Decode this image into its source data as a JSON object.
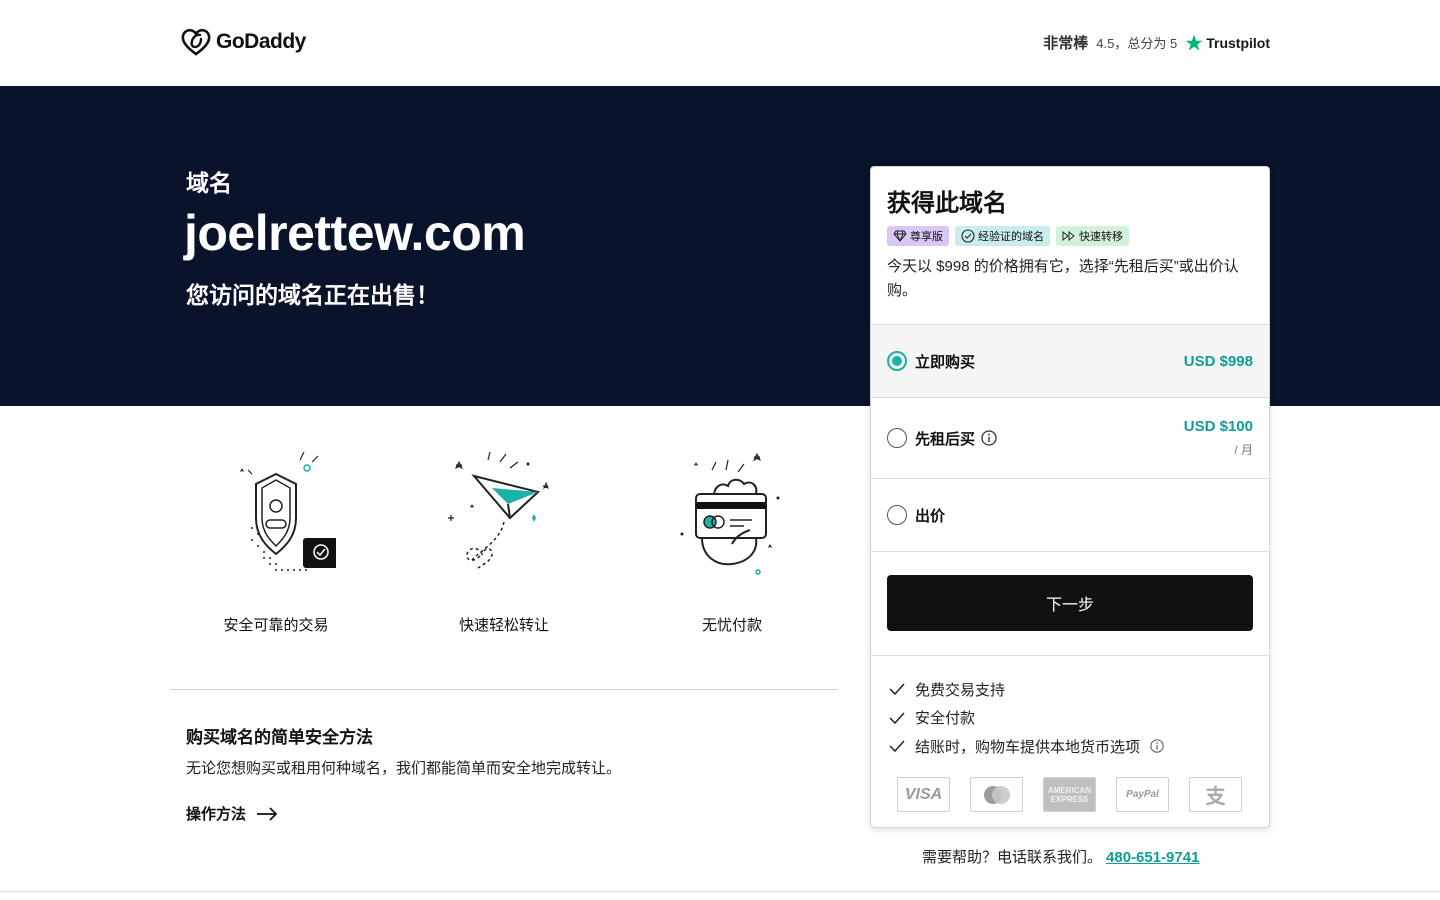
{
  "header": {
    "logo_text": "GoDaddy",
    "rating_word": "非常棒",
    "rating_text": "4.5，总分为 5",
    "trustpilot": "Trustpilot"
  },
  "hero": {
    "kicker": "域名",
    "domain": "joelrettew.com",
    "subtitle": "您访问的域名正在出售！"
  },
  "features": [
    {
      "label": "安全可靠的交易",
      "icon": "shield-lock-icon"
    },
    {
      "label": "快速轻松转让",
      "icon": "paper-plane-icon"
    },
    {
      "label": "无忧付款",
      "icon": "card-hand-icon"
    }
  ],
  "how": {
    "title": "购买域名的简单安全方法",
    "description": "无论您想购买或租用何种域名，我们都能简单而安全地完成转让。",
    "link": "操作方法"
  },
  "card": {
    "title": "获得此域名",
    "badges": {
      "premium": "尊享版",
      "verified": "经验证的域名",
      "fast": "快速转移"
    },
    "description": "今天以 $998 的价格拥有它，选择“先租后买”或出价认购。",
    "options": {
      "buy": {
        "label": "立即购买",
        "price": "USD $998"
      },
      "lease": {
        "label": "先租后买",
        "price": "USD $100",
        "per": "/ 月"
      },
      "offer": {
        "label": "出价"
      }
    },
    "next_button": "下一步",
    "benefits": [
      "免费交易支持",
      "安全付款",
      "结账时，购物车提供本地货币选项"
    ],
    "payments": {
      "visa": "VISA",
      "amex_1": "AMERICAN",
      "amex_2": "EXPRESS",
      "paypal": "PayPal",
      "alipay": "支"
    }
  },
  "help": {
    "text": "需要帮助？电话联系我们。",
    "phone": "480-651-9741"
  },
  "colors": {
    "hero_bg": "#09142b",
    "accent": "#1bb3a7",
    "price": "#0e9e94",
    "button": "#111111"
  }
}
